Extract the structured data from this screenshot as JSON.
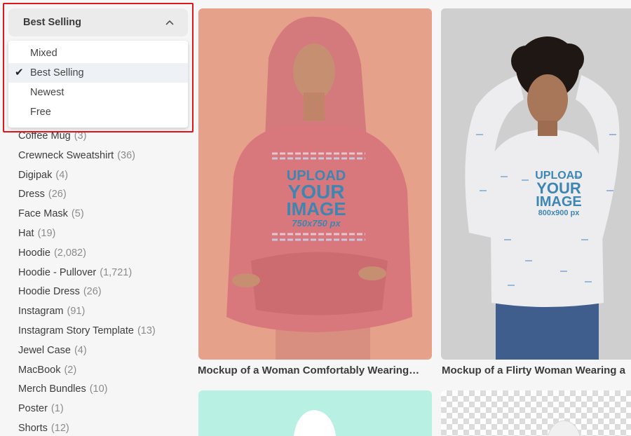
{
  "sort_dropdown": {
    "selected_label": "Best Selling",
    "options": [
      {
        "label": "Mixed",
        "selected": false
      },
      {
        "label": "Best Selling",
        "selected": true
      },
      {
        "label": "Newest",
        "selected": false
      },
      {
        "label": "Free",
        "selected": false
      }
    ],
    "highlight_color": "#e2151b"
  },
  "categories": [
    {
      "label": "Coffee Mug",
      "count": "(3)"
    },
    {
      "label": "Crewneck Sweatshirt",
      "count": "(36)"
    },
    {
      "label": "Digipak",
      "count": "(4)"
    },
    {
      "label": "Dress",
      "count": "(26)"
    },
    {
      "label": "Face Mask",
      "count": "(5)"
    },
    {
      "label": "Hat",
      "count": "(19)"
    },
    {
      "label": "Hoodie",
      "count": "(2,082)"
    },
    {
      "label": "Hoodie - Pullover",
      "count": "(1,721)"
    },
    {
      "label": "Hoodie Dress",
      "count": "(26)"
    },
    {
      "label": "Instagram",
      "count": "(91)"
    },
    {
      "label": "Instagram Story Template",
      "count": "(13)"
    },
    {
      "label": "Jewel Case",
      "count": "(4)"
    },
    {
      "label": "MacBook",
      "count": "(2)"
    },
    {
      "label": "Merch Bundles",
      "count": "(10)"
    },
    {
      "label": "Poster",
      "count": "(1)"
    },
    {
      "label": "Shorts",
      "count": "(12)"
    }
  ],
  "cards": [
    {
      "title": "Mockup of a Woman Comfortably Wearing…",
      "upload_lines": [
        "UPLOAD",
        "YOUR",
        "IMAGE"
      ],
      "size": "750x750 px",
      "bg": "#e6a18a",
      "garment": "#d9787c"
    },
    {
      "title": "Mockup of a Flirty Woman Wearing a",
      "upload_lines": [
        "UPLOAD",
        "YOUR",
        "IMAGE"
      ],
      "size": "800x900 px",
      "bg": "#cfcfcf",
      "garment": "#ededf0"
    },
    {
      "title": "",
      "bg": "#b8f1e4"
    },
    {
      "title": "",
      "bg": "checker"
    }
  ]
}
